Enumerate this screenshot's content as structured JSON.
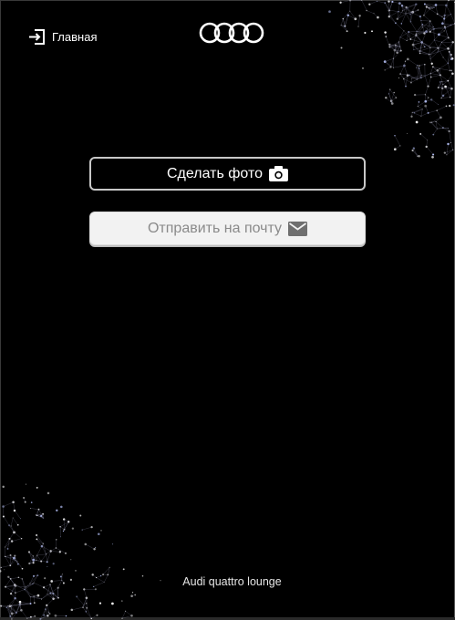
{
  "header": {
    "home_label": "Главная"
  },
  "actions": {
    "take_photo_label": "Сделать фото",
    "send_email_label": "Отправить на почту"
  },
  "footer": {
    "caption": "Audi quattro lounge"
  },
  "icons": {
    "home": "exit-arrow-icon",
    "logo": "audi-rings-logo",
    "photo": "camera-icon",
    "mail": "envelope-icon"
  },
  "colors": {
    "background": "#000000",
    "photo_button_border": "#c8c8c8",
    "mail_button_bg": "#f2f2f2",
    "mail_button_text": "#8a8a8a"
  }
}
